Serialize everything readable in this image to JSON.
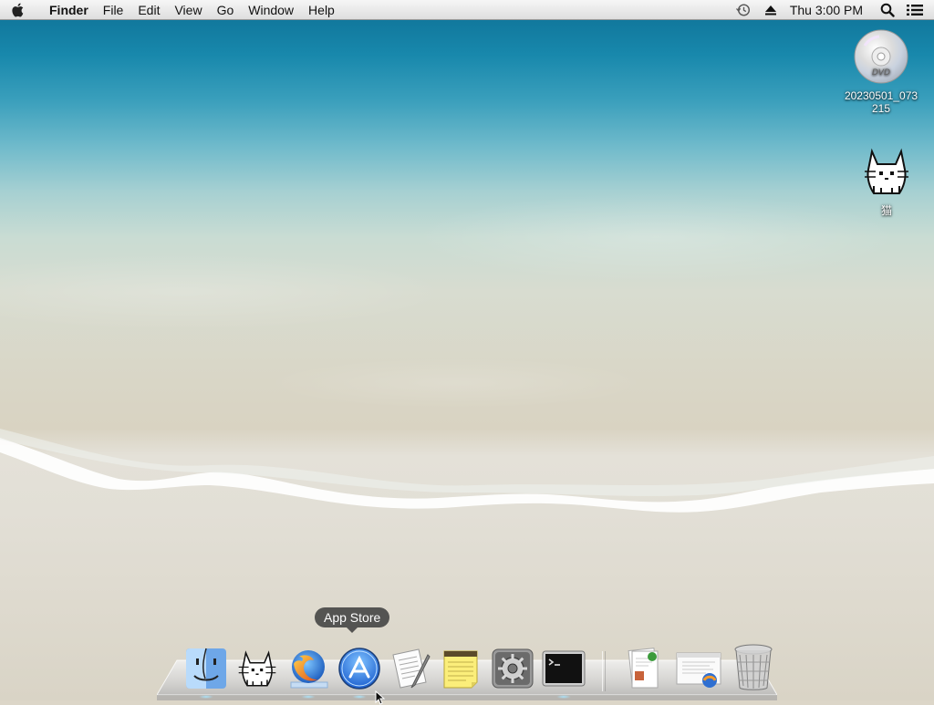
{
  "menubar": {
    "app_name": "Finder",
    "menus": [
      "File",
      "Edit",
      "View",
      "Go",
      "Window"
    ],
    "help": "Help",
    "clock": "Thu 3:00 PM"
  },
  "desktop": {
    "icons": [
      {
        "label": "20230501_073215",
        "icon": "dvd-icon"
      },
      {
        "label": "猫",
        "icon": "cat-icon"
      }
    ]
  },
  "dock": {
    "tooltip": "App Store",
    "items": [
      {
        "name": "Finder",
        "icon": "finder-icon",
        "running": true
      },
      {
        "name": "Cat app",
        "icon": "cat-icon",
        "running": false
      },
      {
        "name": "Firefox",
        "icon": "firefox-icon",
        "running": true
      },
      {
        "name": "App Store",
        "icon": "app-store-icon",
        "running": true
      },
      {
        "name": "TextEdit",
        "icon": "textedit-icon",
        "running": false
      },
      {
        "name": "Stickies",
        "icon": "stickies-icon",
        "running": false
      },
      {
        "name": "System Preferences",
        "icon": "system-preferences-icon",
        "running": false
      },
      {
        "name": "Terminal",
        "icon": "terminal-icon",
        "running": true
      },
      {
        "name": "Documents stack",
        "icon": "documents-stack-icon",
        "running": false
      },
      {
        "name": "Downloads stack",
        "icon": "downloads-stack-icon",
        "running": false
      },
      {
        "name": "Trash",
        "icon": "trash-icon",
        "running": false
      }
    ]
  }
}
